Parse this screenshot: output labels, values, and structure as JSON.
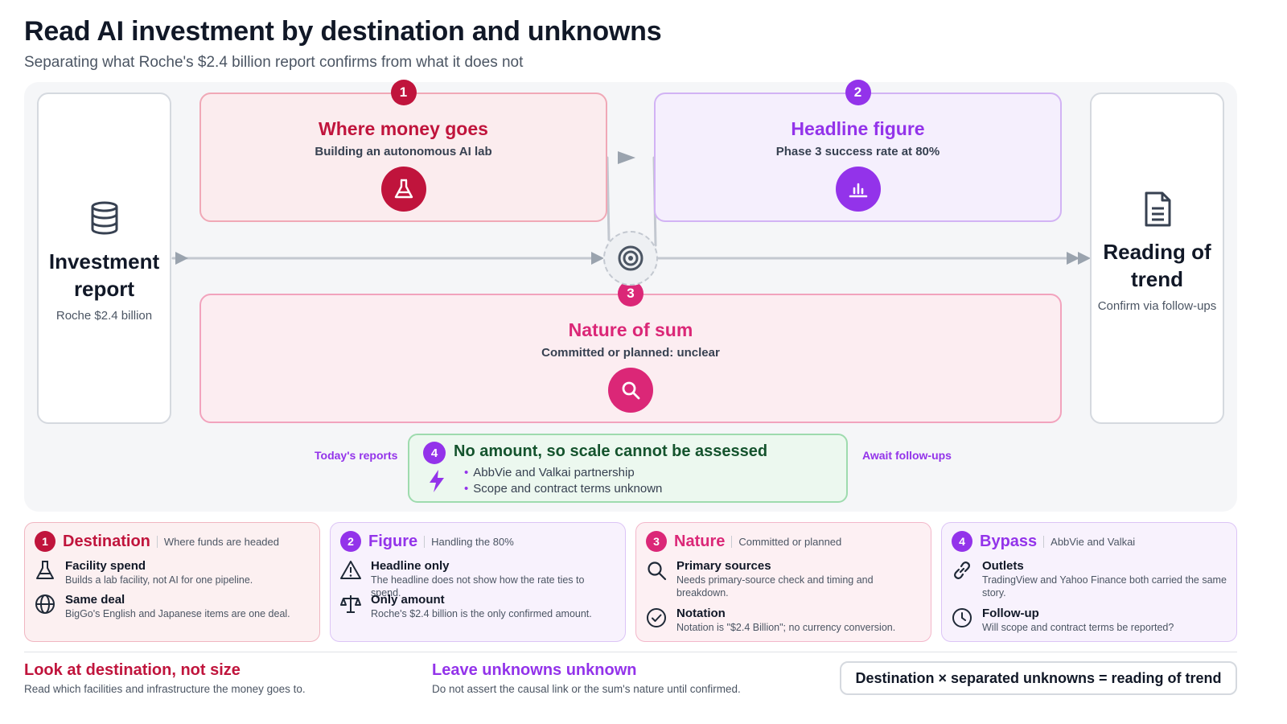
{
  "header": {
    "title": "Read AI investment by destination and unknowns",
    "subtitle": "Separating what Roche's $2.4 billion report confirms from what it does not"
  },
  "flow": {
    "start": {
      "title": "Investment report",
      "sub": "Roche $2.4 billion",
      "icon": "database-icon"
    },
    "end": {
      "title": "Reading of trend",
      "sub": "Confirm via follow-ups",
      "icon": "document-icon"
    },
    "hub_icon": "target-icon",
    "stages": [
      {
        "num": "1",
        "title": "Where money goes",
        "sub": "Building an autonomous AI lab",
        "icon": "flask-icon",
        "color": "#c0143c"
      },
      {
        "num": "2",
        "title": "Headline figure",
        "sub": "Phase 3 success rate at 80%",
        "icon": "bar-chart-icon",
        "color": "#9333ea"
      },
      {
        "num": "3",
        "title": "Nature of sum",
        "sub": "Committed or planned: unclear",
        "icon": "search-icon",
        "color": "#db2777"
      }
    ],
    "bypass": {
      "num": "4",
      "title": "No amount, so scale cannot be assessed",
      "items": [
        "AbbVie and Valkai partnership",
        "Scope and contract terms unknown"
      ],
      "left_label": "Today's reports",
      "right_label": "Await follow-ups",
      "icon": "lightning-icon"
    }
  },
  "panels": [
    {
      "num": "1",
      "title": "Destination",
      "tag": "Where funds are headed",
      "items": [
        {
          "title": "Facility spend",
          "desc": "Builds a lab facility, not AI for one pipeline.",
          "icon": "flask-icon"
        },
        {
          "title": "Same deal",
          "desc": "BigGo's English and Japanese items are one deal.",
          "icon": "globe-icon"
        }
      ]
    },
    {
      "num": "2",
      "title": "Figure",
      "tag": "Handling the 80%",
      "items": [
        {
          "title": "Headline only",
          "desc": "The headline does not show how the rate ties to spend.",
          "icon": "warning-icon"
        },
        {
          "title": "Only amount",
          "desc": "Roche's $2.4 billion is the only confirmed amount.",
          "icon": "scale-icon"
        }
      ]
    },
    {
      "num": "3",
      "title": "Nature",
      "tag": "Committed or planned",
      "items": [
        {
          "title": "Primary sources",
          "desc": "Needs primary-source check and timing and breakdown.",
          "icon": "search-icon"
        },
        {
          "title": "Notation",
          "desc": "Notation is \"$2.4 Billion\"; no currency conversion.",
          "icon": "check-circle-icon"
        }
      ]
    },
    {
      "num": "4",
      "title": "Bypass",
      "tag": "AbbVie and Valkai",
      "items": [
        {
          "title": "Outlets",
          "desc": "TradingView and Yahoo Finance both carried the same story.",
          "icon": "link-icon"
        },
        {
          "title": "Follow-up",
          "desc": "Will scope and contract terms be reported?",
          "icon": "clock-icon"
        }
      ]
    }
  ],
  "footer": {
    "left": {
      "title": "Look at destination, not size",
      "desc": "Read which facilities and infrastructure the money goes to."
    },
    "middle": {
      "title": "Leave unknowns unknown",
      "desc": "Do not assert the causal link or the sum's nature until confirmed."
    },
    "formula": "Destination × separated unknowns = reading of trend"
  }
}
